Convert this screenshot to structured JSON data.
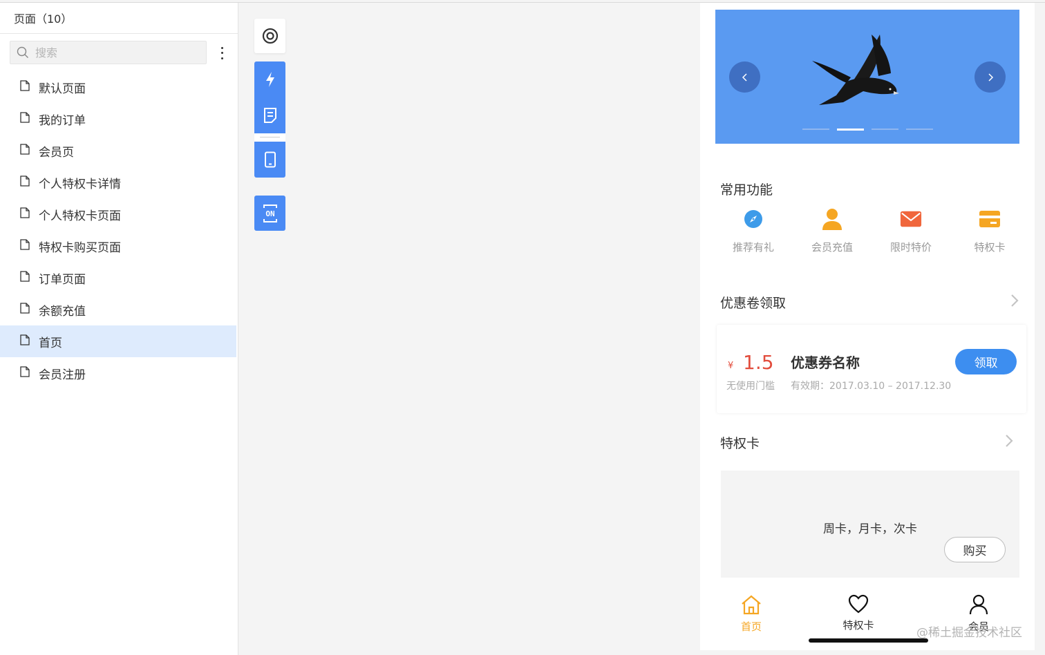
{
  "sidebar": {
    "header": "页面（10）",
    "search_placeholder": "搜索",
    "items": [
      {
        "label": "默认页面"
      },
      {
        "label": "我的订单"
      },
      {
        "label": "会员页"
      },
      {
        "label": "个人特权卡详情"
      },
      {
        "label": "个人特权卡页面"
      },
      {
        "label": "特权卡购买页面"
      },
      {
        "label": "订单页面"
      },
      {
        "label": "余额充值"
      },
      {
        "label": "首页",
        "active": true
      },
      {
        "label": "会员注册"
      }
    ]
  },
  "toolbar": {
    "icons": [
      "target-icon",
      "lightning-icon",
      "document-icon",
      "phone-icon",
      "json-icon"
    ],
    "json_label": "ON",
    "accent": "#4a8af4"
  },
  "preview": {
    "banner": {
      "bg": "#5a9af1",
      "slide_count": 4,
      "active_slide": 1
    },
    "common_functions": {
      "title": "常用功能",
      "items": [
        {
          "label": "推荐有礼",
          "icon": "compass-icon",
          "color": "#3d9be9"
        },
        {
          "label": "会员充值",
          "icon": "user-icon",
          "color": "#f5a623"
        },
        {
          "label": "限时特价",
          "icon": "mail-icon",
          "color": "#f0663c"
        },
        {
          "label": "特权卡",
          "icon": "card-icon",
          "color": "#f5a623"
        }
      ]
    },
    "coupons": {
      "title": "优惠卷领取",
      "currency": "¥",
      "amount": "1.5",
      "name": "优惠券名称",
      "threshold": "无使用门槛",
      "validity": "有效期：2017.03.10 – 2017.12.30",
      "button": "领取"
    },
    "privilege_card": {
      "title": "特权卡",
      "types": "周卡，月卡，次卡",
      "button": "购买"
    },
    "tabbar": {
      "items": [
        {
          "label": "首页",
          "icon": "home-icon",
          "active": true
        },
        {
          "label": "特权卡",
          "icon": "heart-icon"
        },
        {
          "label": "会员",
          "icon": "person-icon"
        }
      ],
      "active_color": "#f5a623"
    },
    "watermark": "@稀土掘金技术社区"
  }
}
